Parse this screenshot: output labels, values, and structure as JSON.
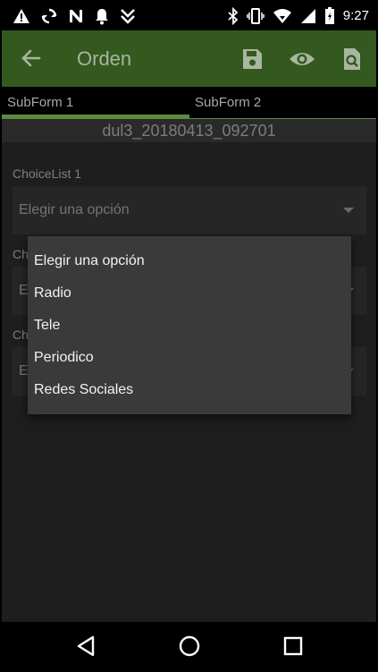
{
  "status_bar": {
    "time": "9:27",
    "left_icons": [
      "warning-icon",
      "sync-icon",
      "n-icon",
      "bell-icon",
      "download-icon"
    ],
    "right_icons": [
      "bluetooth-icon",
      "vibrate-icon",
      "wifi-icon",
      "signal-icon",
      "battery-icon"
    ]
  },
  "app_bar": {
    "title": "Orden",
    "back_icon": "arrow-left-icon",
    "actions": [
      "save-icon",
      "eye-icon",
      "search-document-icon"
    ],
    "background": "#33591f"
  },
  "tabs": [
    {
      "label": "SubForm 1",
      "active": true
    },
    {
      "label": "SubForm 2",
      "active": false
    }
  ],
  "record_id": "dul3_20180413_092701",
  "fields": [
    {
      "label": "ChoiceList 1",
      "value": "Elegir una opción"
    },
    {
      "label": "Ch",
      "value": "E"
    },
    {
      "label": "Ch",
      "value": "E"
    }
  ],
  "dropdown": {
    "options": [
      "Elegir una opción",
      "Radio",
      "Tele",
      "Periodico",
      "Redes Sociales"
    ]
  },
  "nav_bar": {
    "buttons": [
      "back-triangle-icon",
      "home-circle-icon",
      "recents-square-icon"
    ]
  }
}
